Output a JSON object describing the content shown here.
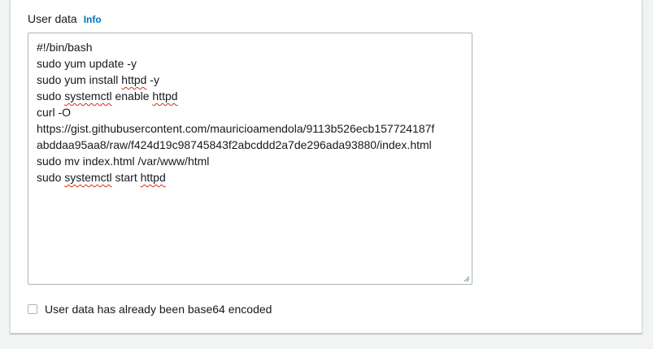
{
  "user_data_field": {
    "label": "User data",
    "info_link": "Info",
    "lines": [
      [
        "#!/bin/bash"
      ],
      [
        "sudo yum update -y"
      ],
      [
        "sudo yum install ",
        {
          "s": "httpd"
        },
        " -y"
      ],
      [
        "sudo ",
        {
          "s": "systemctl"
        },
        " enable ",
        {
          "s": "httpd"
        }
      ],
      [
        "curl -O"
      ],
      [
        "https://gist.githubusercontent.com/mauricioamendola/9113b526ecb157724187f"
      ],
      [
        "abddaa95aa8/raw/f424d19c98745843f2abcddd2a7de296ada93880/index.html"
      ],
      [
        "sudo mv index.html /var/www/html"
      ],
      [
        "sudo ",
        {
          "s": "systemctl"
        },
        " start ",
        {
          "s": "httpd"
        }
      ]
    ]
  },
  "base64_checkbox": {
    "label": "User data has already been base64 encoded",
    "checked": false
  },
  "colors": {
    "info_link": "#0073bb",
    "spellcheck_underline": "#d13212",
    "border": "#aab7b8"
  }
}
